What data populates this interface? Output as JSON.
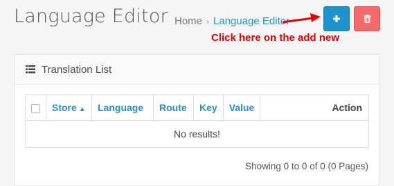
{
  "header": {
    "title": "Language Editor",
    "breadcrumb": {
      "home": "Home",
      "separator": "›",
      "current": "Language Editor"
    }
  },
  "actions": {
    "add_icon": "plus-icon",
    "delete_icon": "trash-icon",
    "add_color": "#1e91cf",
    "delete_color": "#f56b6b"
  },
  "annotation": {
    "text": "Click here on the add new",
    "color": "#e60000"
  },
  "panel": {
    "title": "Translation List",
    "icon": "list-icon",
    "table": {
      "columns": [
        "Store",
        "Language",
        "Route",
        "Key",
        "Value",
        "Action"
      ],
      "sort_indicator": "^",
      "empty_message": "No results!"
    },
    "pagination_text": "Showing 0 to 0 of 0 (0 Pages)"
  }
}
